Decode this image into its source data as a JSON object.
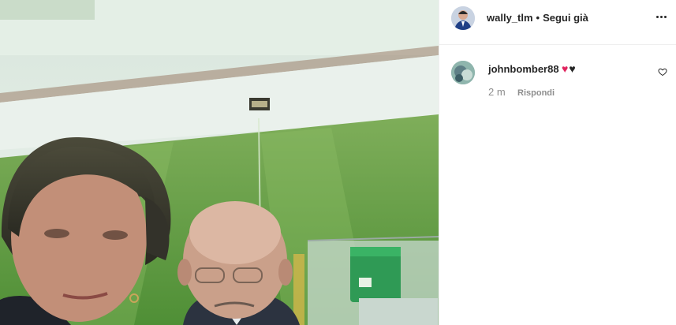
{
  "post": {
    "owner_username": "wally_tlm",
    "separator": "•",
    "follow_status": "Segui già"
  },
  "comments": [
    {
      "username": "johnbomber88",
      "emoji_text": "♥♥",
      "time": "2 m",
      "reply_label": "Rispondi"
    }
  ],
  "icons": {
    "more": "more-horizontal-icon",
    "like": "heart-outline-icon"
  },
  "colors": {
    "text": "#262626",
    "muted": "#8e8e8e",
    "heart_red": "#e0245e",
    "border": "#efefef"
  }
}
